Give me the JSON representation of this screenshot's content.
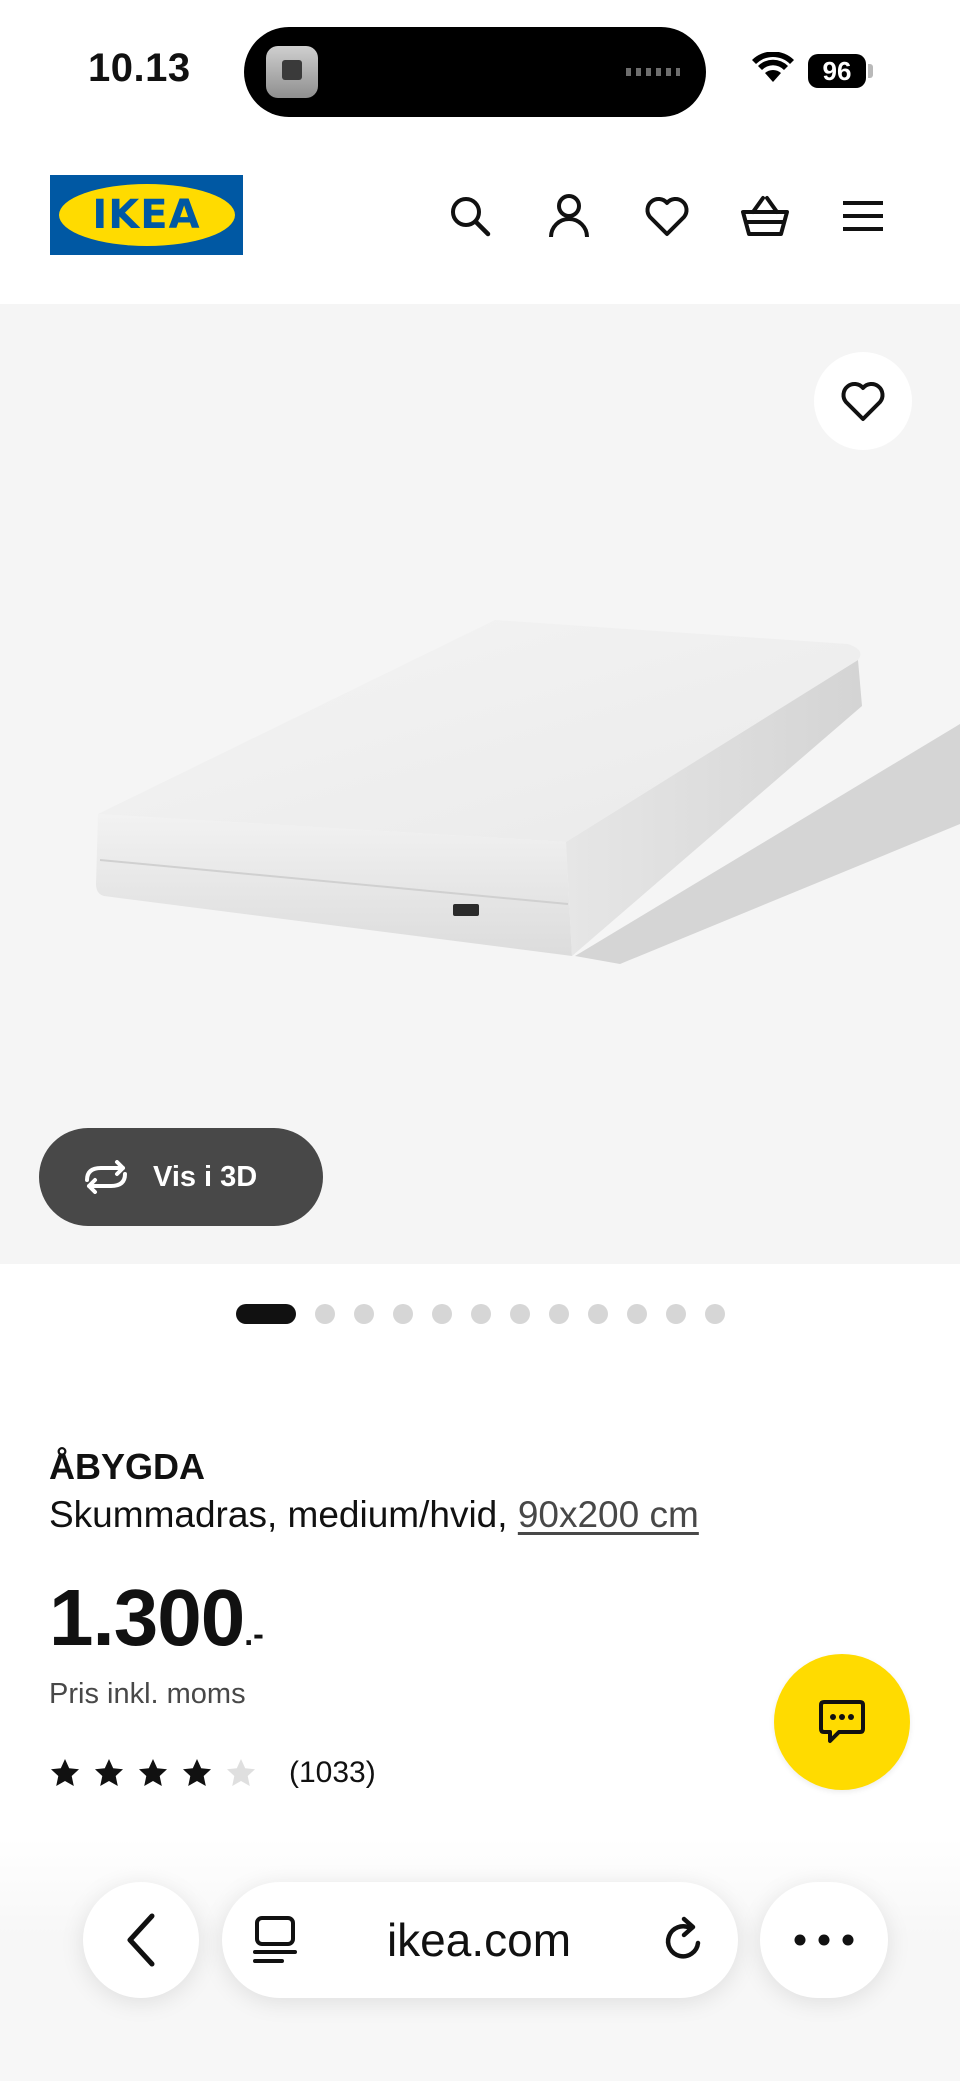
{
  "status_bar": {
    "time": "10.13",
    "battery": "96",
    "icons": [
      "wifi-icon",
      "battery-icon"
    ]
  },
  "header": {
    "logo_text": "IKEA",
    "logo_colors": {
      "background": "#0058a3",
      "oval": "#ffdb00"
    },
    "icons": [
      "search-icon",
      "account-icon",
      "heart-icon",
      "cart-icon",
      "menu-icon"
    ]
  },
  "hero": {
    "favorite_icon": "heart-icon",
    "view_3d_label": "Vis i 3D",
    "view_3d_icon": "rotate-3d-icon",
    "image_count": 13,
    "active_image": 1
  },
  "product": {
    "name": "ÅBYGDA",
    "description": "Skummadras, medium/hvid,",
    "dimension_link": "90x200 cm",
    "price_integer": "1.300",
    "price_suffix": ".-",
    "price_note": "Pris inkl. moms",
    "rating": {
      "value": 4,
      "max": 5,
      "count_label": "(1033)"
    }
  },
  "chat": {
    "icon": "chat-icon",
    "color": "#ffdb00"
  },
  "browser": {
    "url": "ikea.com",
    "icons": [
      "back-icon",
      "tabs-icon",
      "reload-icon",
      "more-icon"
    ]
  }
}
